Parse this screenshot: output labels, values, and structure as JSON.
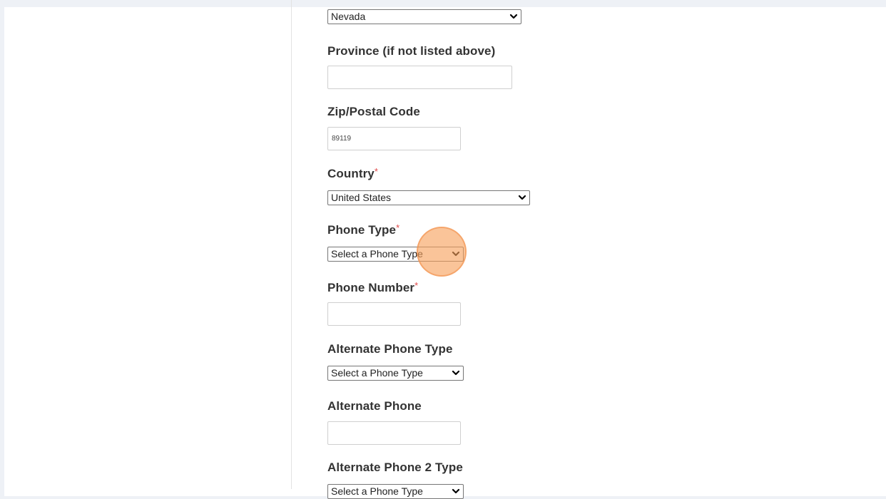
{
  "form": {
    "state": {
      "selected": "Nevada"
    },
    "province": {
      "label": "Province (if not listed above)",
      "value": ""
    },
    "zip": {
      "label": "Zip/Postal Code",
      "value": "89119"
    },
    "country": {
      "label": "Country",
      "required_mark": "*",
      "selected": "United States"
    },
    "phone_type": {
      "label": "Phone Type",
      "required_mark": "*",
      "selected": "Select a Phone Type"
    },
    "phone_number": {
      "label": "Phone Number",
      "required_mark": "*",
      "value": ""
    },
    "alt_phone_type": {
      "label": "Alternate Phone Type",
      "selected": "Select a Phone Type"
    },
    "alt_phone": {
      "label": "Alternate Phone",
      "value": ""
    },
    "alt_phone2_type": {
      "label": "Alternate Phone 2 Type",
      "selected": "Select a Phone Type"
    }
  },
  "icons": {
    "dropdown": "chevron-down-icon"
  },
  "colors": {
    "required_mark": "#e04848",
    "click_indicator": "#f7a05a"
  }
}
